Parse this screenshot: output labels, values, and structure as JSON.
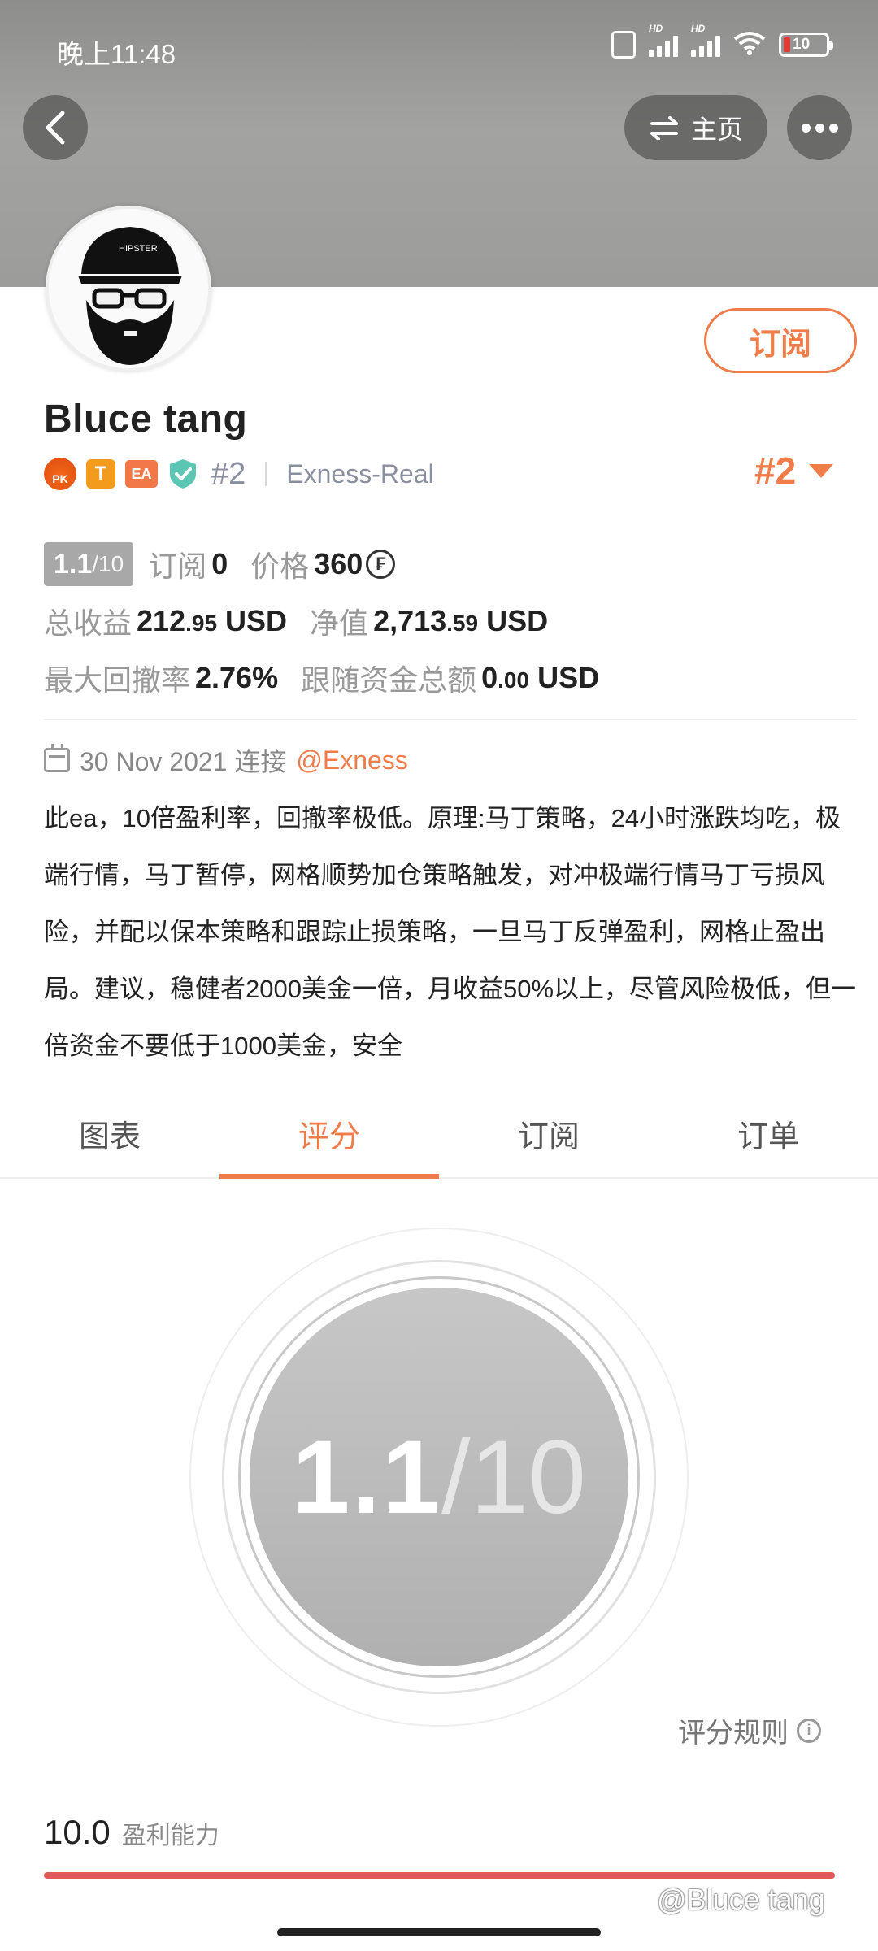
{
  "status_bar": {
    "time": "晚上11:48",
    "hd1": "HD",
    "hd2": "HD",
    "battery": "10"
  },
  "header": {
    "home_label": "主页"
  },
  "profile": {
    "name": "Bluce tang",
    "badges": {
      "pk": "PK",
      "t": "T",
      "ea": "EA"
    },
    "rank_inline": "#2",
    "server": "Exness-Real",
    "rank_big": "#2",
    "subscribe_label": "订阅"
  },
  "stats": {
    "score": "1.1",
    "score_of": "/10",
    "subscribe_label": "订阅",
    "subscribe_count": "0",
    "price_label": "价格",
    "price_value": "360",
    "coin_symbol": "₣",
    "total_profit_label": "总收益",
    "total_profit_int": "212",
    "total_profit_dec": ".95",
    "currency": "USD",
    "equity_label": "净值",
    "equity_int": "2,713",
    "equity_dec": ".59",
    "drawdown_label": "最大回撤率",
    "drawdown_value": "2.76%",
    "follow_label": "跟随资金总额",
    "follow_int": "0",
    "follow_dec": ".00"
  },
  "connection": {
    "date_text": "30 Nov 2021 连接",
    "broker": "@Exness"
  },
  "description": "此ea，10倍盈利率，回撤率极低。原理:马丁策略，24小时涨跌均吃，极端行情，马丁暂停，网格顺势加仓策略触发，对冲极端行情马丁亏损风险，并配以保本策略和跟踪止损策略，一旦马丁反弹盈利，网格止盈出局。建议，稳健者2000美金一倍，月收益50%以上，尽管风险极低，但一倍资金不要低于1000美金，安全",
  "tabs": [
    {
      "label": "图表"
    },
    {
      "label": "评分"
    },
    {
      "label": "订阅"
    },
    {
      "label": "订单"
    }
  ],
  "score_circle": {
    "score": "1.1",
    "of": "/10"
  },
  "rules_label": "评分规则",
  "metrics": [
    {
      "value": "10.0",
      "label": "盈利能力",
      "fraction": 1.0
    }
  ],
  "watermark": "@Bluce tang",
  "colors": {
    "accent": "#f07c4a",
    "metric_bar": "#e05a5a",
    "chip_gray": "#a8a8a8"
  }
}
